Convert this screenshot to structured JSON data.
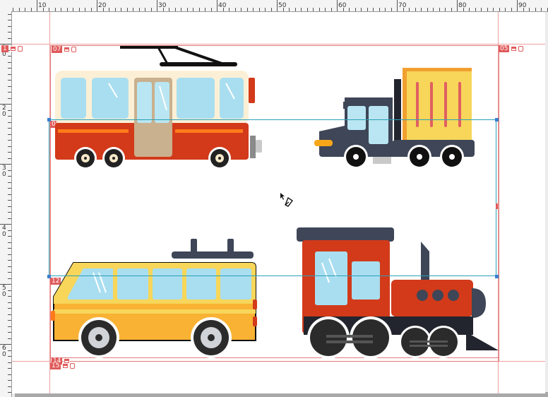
{
  "rulers": {
    "top_labels": [
      "10",
      "20",
      "30",
      "40",
      "50",
      "60",
      "70",
      "80",
      "90"
    ],
    "left_labels": [
      "1\n0",
      "2\n0",
      "3\n0",
      "4\n0",
      "5\n0",
      "6\n0"
    ]
  },
  "frames": {
    "f07": "07",
    "f05": "05",
    "f08": "08",
    "f12": "12",
    "f14": "14",
    "f15": "15",
    "f01": "1"
  },
  "cursor": "pen-tool-cursor",
  "illustrations": [
    "trolleybus",
    "truck",
    "minibus",
    "steam-locomotive"
  ],
  "colors": {
    "selection": "#2aa0b8",
    "guide": "#f0a0a0",
    "frame": "#e07a7a",
    "bus_red": "#d23a1a",
    "bus_cream": "#fbf0d6",
    "truck_body": "#3e4657",
    "cargo_yellow": "#f7d65a",
    "van_yellow": "#f9b233",
    "window_blue": "#a9def0"
  }
}
